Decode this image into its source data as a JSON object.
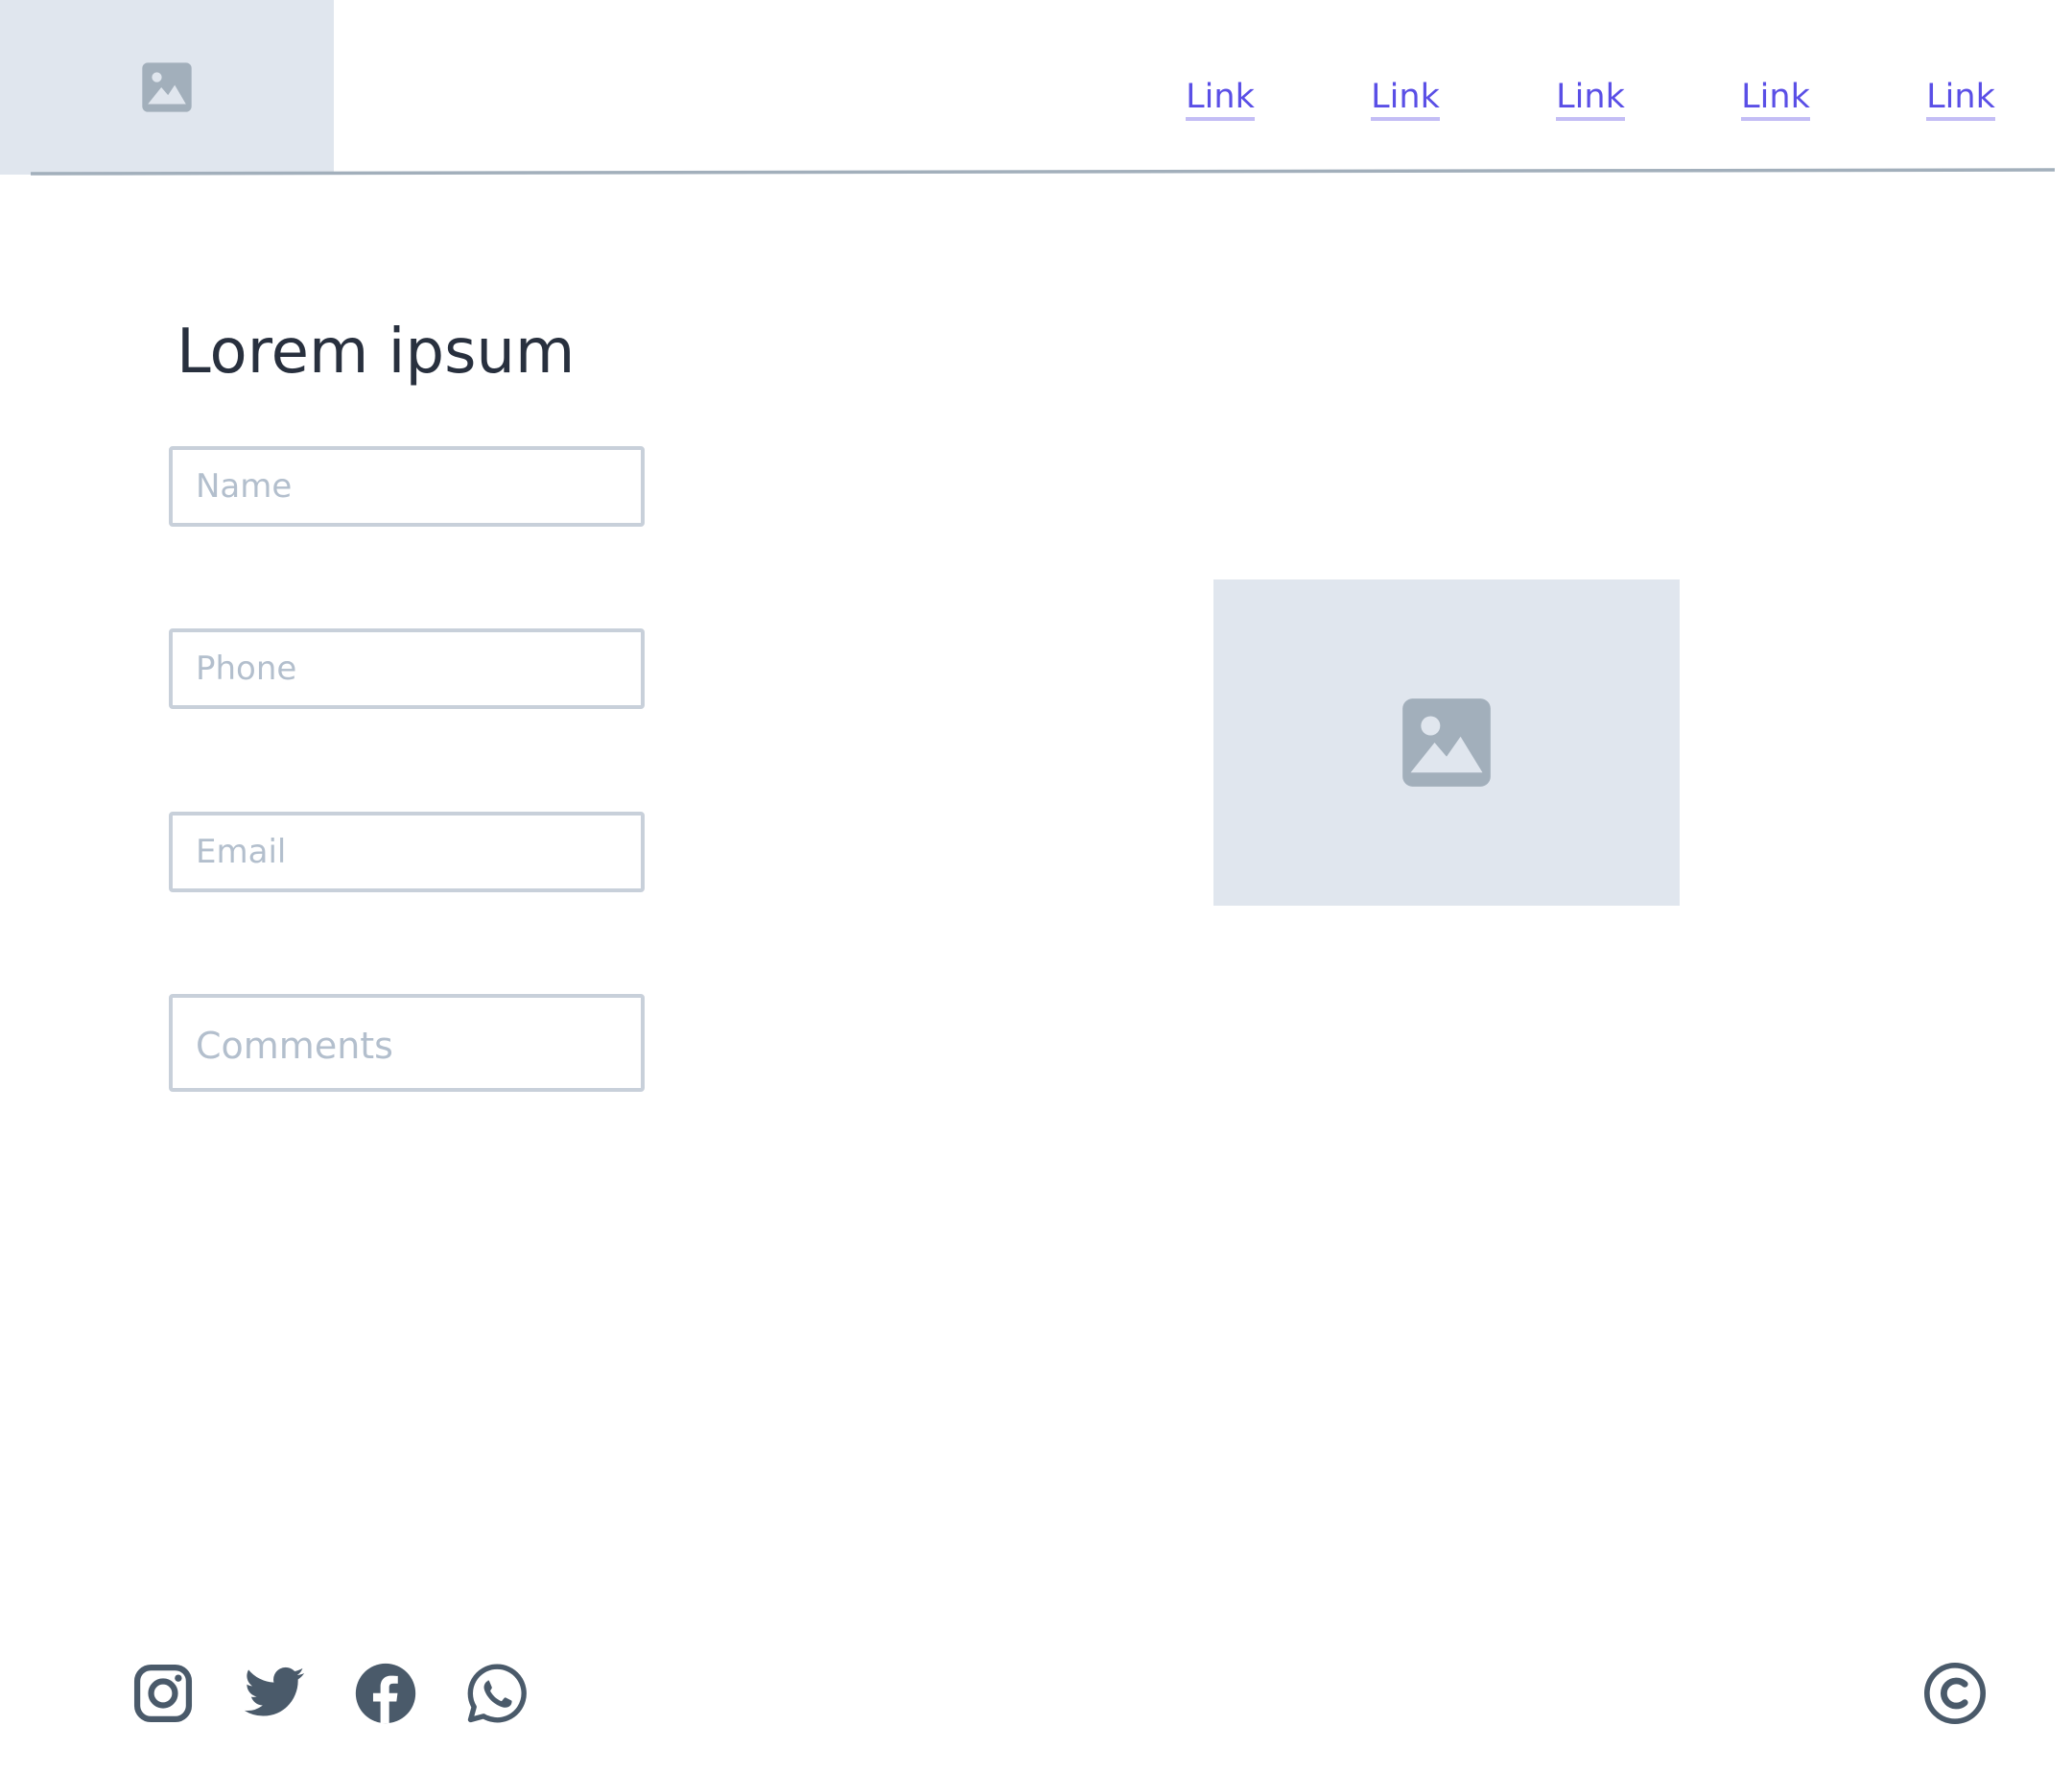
{
  "header": {
    "nav_links": [
      {
        "label": "Link"
      },
      {
        "label": "Link"
      },
      {
        "label": "Link"
      },
      {
        "label": "Link"
      },
      {
        "label": "Link"
      }
    ]
  },
  "main": {
    "title": "Lorem ipsum",
    "form": {
      "name_placeholder": "Name",
      "phone_placeholder": "Phone",
      "email_placeholder": "Email",
      "comments_placeholder": "Comments"
    }
  },
  "icons": {
    "logo": "image-placeholder-icon",
    "hero": "image-placeholder-icon",
    "footer": [
      "instagram-icon",
      "twitter-icon",
      "facebook-icon",
      "whatsapp-icon",
      "copyright-icon"
    ]
  },
  "colors": {
    "link": "#5a4fe6",
    "link_underline": "#c3bdf5",
    "placeholder_bg": "#e0e6ee",
    "placeholder_icon": "#a2afbb",
    "text_dark": "#28303e",
    "field_border": "#c8d0da",
    "field_placeholder": "#b3bfcd",
    "footer_icon": "#4a5a6a",
    "divider": "#a2afbb"
  }
}
